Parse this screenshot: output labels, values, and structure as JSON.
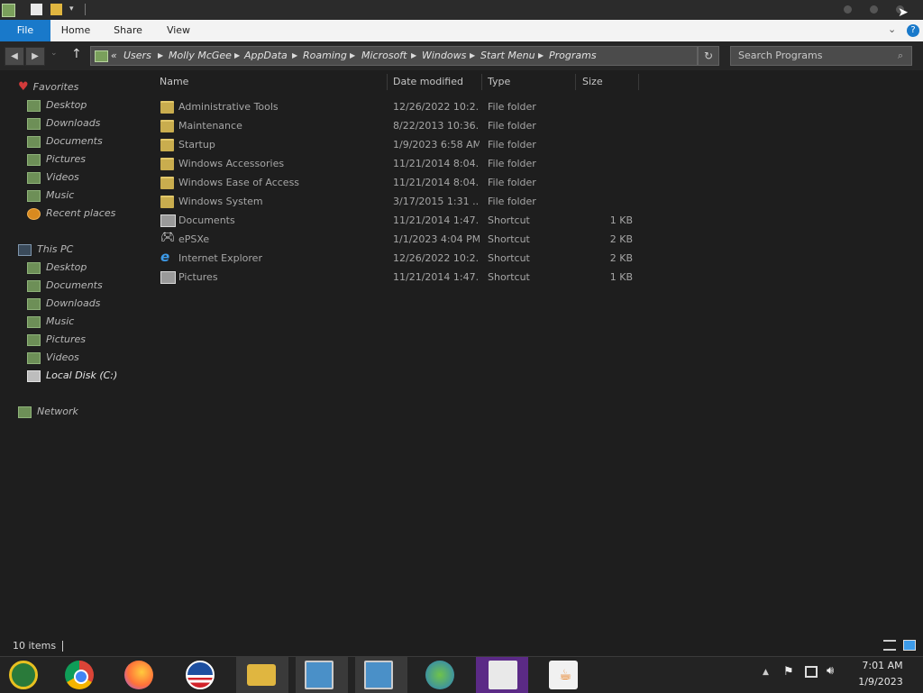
{
  "window": {
    "ribbon_tabs": {
      "file": "File",
      "home": "Home",
      "share": "Share",
      "view": "View"
    }
  },
  "address": {
    "overflow": "«",
    "crumbs": [
      "Users",
      "Molly McGee",
      "AppData",
      "Roaming",
      "Microsoft",
      "Windows",
      "Start Menu",
      "Programs"
    ]
  },
  "search": {
    "placeholder": "Search Programs"
  },
  "nav": {
    "favorites": {
      "label": "Favorites",
      "items": [
        "Desktop",
        "Downloads",
        "Documents",
        "Pictures",
        "Videos",
        "Music",
        "Recent places"
      ]
    },
    "this_pc": {
      "label": "This PC",
      "items": [
        "Desktop",
        "Documents",
        "Downloads",
        "Music",
        "Pictures",
        "Videos",
        "Local Disk (C:)"
      ]
    },
    "network": {
      "label": "Network"
    }
  },
  "columns": {
    "name": "Name",
    "date": "Date modified",
    "type": "Type",
    "size": "Size"
  },
  "files": [
    {
      "name": "Administrative Tools",
      "date": "12/26/2022 10:2...",
      "type": "File folder",
      "size": "",
      "icon": "folder-icon"
    },
    {
      "name": "Maintenance",
      "date": "8/22/2013 10:36...",
      "type": "File folder",
      "size": "",
      "icon": "folder-icon"
    },
    {
      "name": "Startup",
      "date": "1/9/2023 6:58 AM",
      "type": "File folder",
      "size": "",
      "icon": "folder-icon"
    },
    {
      "name": "Windows Accessories",
      "date": "11/21/2014 8:04...",
      "type": "File folder",
      "size": "",
      "icon": "folder-icon"
    },
    {
      "name": "Windows Ease of Access",
      "date": "11/21/2014 8:04...",
      "type": "File folder",
      "size": "",
      "icon": "folder-icon"
    },
    {
      "name": "Windows System",
      "date": "3/17/2015 1:31 ...",
      "type": "File folder",
      "size": "",
      "icon": "folder-icon"
    },
    {
      "name": "Documents",
      "date": "11/21/2014 1:47...",
      "type": "Shortcut",
      "size": "1 KB",
      "icon": "library-shortcut-icon"
    },
    {
      "name": "ePSXe",
      "date": "1/1/2023 4:04 PM",
      "type": "Shortcut",
      "size": "2 KB",
      "icon": "gamepad-icon"
    },
    {
      "name": "Internet Explorer",
      "date": "12/26/2022 10:2...",
      "type": "Shortcut",
      "size": "2 KB",
      "icon": "internet-explorer-icon"
    },
    {
      "name": "Pictures",
      "date": "11/21/2014 1:47...",
      "type": "Shortcut",
      "size": "1 KB",
      "icon": "library-shortcut-icon"
    }
  ],
  "status": {
    "items": "10 items"
  },
  "taskbar": {
    "apps": [
      "media-center-icon",
      "chrome-icon",
      "firefox-icon",
      "obama-logo-icon",
      "file-explorer-icon",
      "network-setup-icon",
      "network-setup-icon",
      "messenger-icon",
      "task-list-icon",
      "java-icon"
    ],
    "time": "7:01 AM",
    "date": "1/9/2023"
  },
  "colors": {
    "accent": "#1979ca",
    "window_bg": "#1e1e1e",
    "folder": "#c9ad4e"
  }
}
